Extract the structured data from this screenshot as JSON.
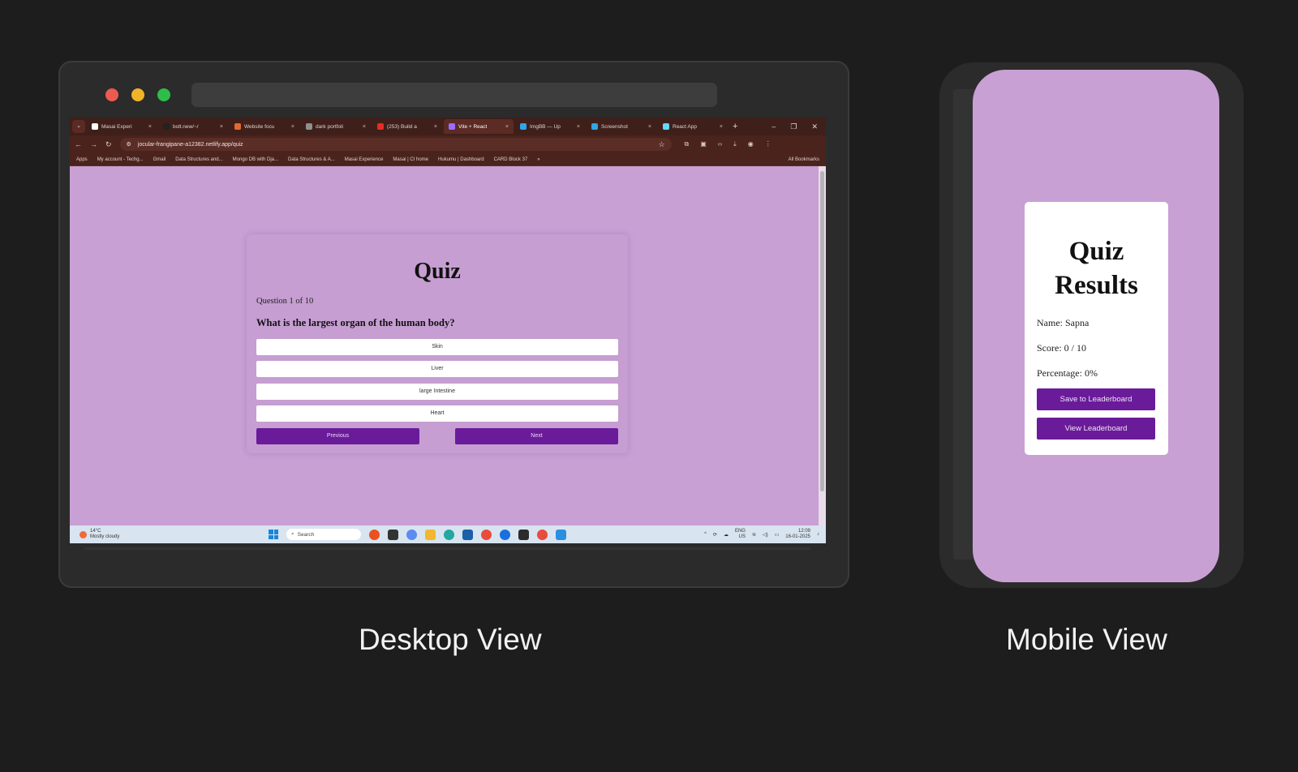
{
  "desktop": {
    "caption": "Desktop View",
    "tabs": [
      {
        "label": "Masai Experi",
        "color": "#ffffff"
      },
      {
        "label": "bolt.new/~/",
        "color": "#222222"
      },
      {
        "label": "Website focu",
        "color": "#e26a32"
      },
      {
        "label": "dark portfoli",
        "color": "#8f8f8f"
      },
      {
        "label": "(253) Build a",
        "color": "#e52d27"
      },
      {
        "label": "Vite + React",
        "color": "#9b6cff",
        "active": true
      },
      {
        "label": "ImgBB — Up",
        "color": "#2fa4e7"
      },
      {
        "label": "Screenshot",
        "color": "#2fa4e7"
      },
      {
        "label": "React App",
        "color": "#61dafb"
      }
    ],
    "url": "jocular-frangipane-a12382.netlify.app/quiz",
    "bookmarks": [
      "Apps",
      "My account - Techg...",
      "Gmail",
      "Data Structures and...",
      "Mongo DB with Dja...",
      "Data Structures & A...",
      "Masai Experience",
      "Masai | CI home",
      "Hukumu | Dashboard",
      "CARD Block 37"
    ],
    "all_bookmarks": "All Bookmarks",
    "quiz": {
      "title": "Quiz",
      "question_number": "Question 1 of 10",
      "question": "What is the largest organ of the human body?",
      "options": [
        "Skin",
        "Liver",
        "large Intestine",
        "Heart"
      ],
      "previous_label": "Previous",
      "next_label": "Next"
    },
    "taskbar": {
      "temperature": "14°C",
      "weather": "Mostly cloudy",
      "search": "Search",
      "lang_1": "ENG",
      "lang_2": "US",
      "time": "12:09",
      "date": "16-01-2025"
    }
  },
  "mobile": {
    "caption": "Mobile View",
    "results": {
      "title": "Quiz Results",
      "name": "Name: Sapna",
      "score": "Score: 0 / 10",
      "percentage": "Percentage: 0%",
      "save_label": "Save to Leaderboard",
      "view_label": "View Leaderboard"
    }
  },
  "colors": {
    "page_bg": "#c8a0d4",
    "accent": "#6a1b9a",
    "browser_frame": "#4a231d"
  }
}
